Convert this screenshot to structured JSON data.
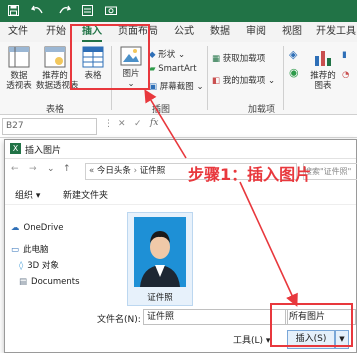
{
  "ribbon_tabs": [
    "文件",
    "开始",
    "插入",
    "页面布局",
    "公式",
    "数据",
    "审阅",
    "视图",
    "开发工具"
  ],
  "active_tab": "插入",
  "ribbon": {
    "pivot_table": "数据\n透视表",
    "recommended_pivot": "推荐的\n数据透视表",
    "table": "表格",
    "table_group": "表格",
    "picture": "图片",
    "shapes": "形状",
    "smartart": "SmartArt",
    "screenshot": "屏幕截图",
    "illustrations_group": "插图",
    "get_addins": "获取加载项",
    "my_addins": "我的加载项",
    "addins_group": "加载项",
    "recommended_charts": "推荐的\n图表"
  },
  "formula_bar": {
    "name_box": "B27",
    "fx": "fx"
  },
  "dialog": {
    "title": "插入图片",
    "breadcrumb": [
      "今日头条",
      "证件照"
    ],
    "search_placeholder": "搜索\"证件照\"",
    "toolbar": {
      "organize": "组织",
      "new_folder": "新建文件夹"
    },
    "nav_items": [
      {
        "label": "OneDrive",
        "icon": "cloud-icon"
      },
      {
        "label": "此电脑",
        "icon": "computer-icon"
      },
      {
        "label": "3D 对象",
        "icon": "cube-icon"
      },
      {
        "label": "Documents",
        "icon": "document-icon"
      }
    ],
    "file": {
      "name": "证件照"
    },
    "footer": {
      "filename_label": "文件名(N):",
      "filename_value": "证件照",
      "filetype": "所有图片",
      "tools": "工具(L)",
      "insert_button": "插入(S)"
    }
  },
  "annotation": "步骤1：插入图片",
  "colors": {
    "excel_green": "#217346",
    "annotation_red": "#e8383d"
  }
}
